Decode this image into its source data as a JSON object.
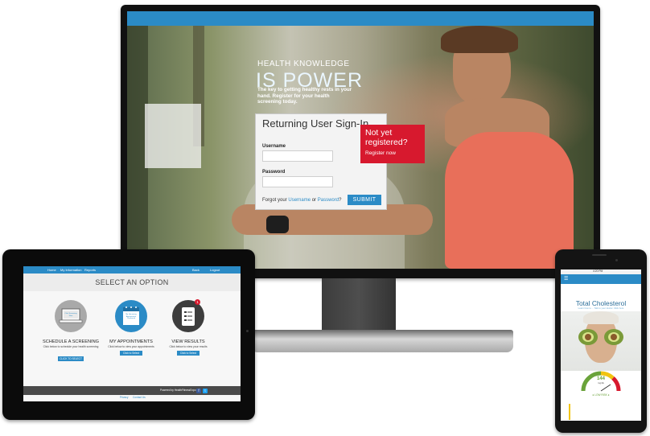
{
  "monitor": {
    "hero": {
      "title_small": "HEALTH KNOWLEDGE",
      "title_big": "IS POWER",
      "subtitle": "The key to getting healthy rests in your hand. Register for your health screening today."
    },
    "signin": {
      "title": "Returning User Sign-In",
      "username_label": "Username",
      "username_value": "",
      "password_label": "Password",
      "password_value": "",
      "forgot_prefix": "Forgot your",
      "forgot_username": "Username",
      "forgot_or": "or",
      "forgot_password": "Password",
      "forgot_suffix": "?",
      "submit_label": "SUBMIT"
    },
    "register": {
      "title": "Not yet registered?",
      "link": "Register now"
    }
  },
  "tablet": {
    "nav_left": [
      "Home",
      "My Information",
      "Reports"
    ],
    "nav_right": [
      "Back",
      "Logout"
    ],
    "heading": "SELECT AN OPTION",
    "options": [
      {
        "title": "SCHEDULE A SCREENING",
        "desc": "Click below to schedule your health screening",
        "button": "CLICK TO SELECT",
        "icon": "laptop-icon",
        "icon_label": "Click Screening Now",
        "circle_color": "#a9a9a9"
      },
      {
        "title": "MY APPOINTMENTS",
        "desc": "Click below to view your appointments",
        "button": "Click to Select",
        "icon": "calendar-icon",
        "icon_label": "My Upcoming Appointment Confirmed",
        "circle_color": "#2b8bc6"
      },
      {
        "title": "VIEW RESULTS",
        "desc": "Click below to view your results",
        "button": "Click to Select",
        "icon": "tablet-results-icon",
        "badge": "1",
        "circle_color": "#3d3d3d"
      }
    ],
    "footer_text": "Powered by HealthFitnessExpo",
    "footer_links": [
      "Privacy",
      "Contact Us"
    ],
    "social": [
      "f",
      "t"
    ]
  },
  "phone": {
    "status_time": "4:20 PM",
    "menu_icon": "hamburger-icon",
    "title": "Total Cholesterol",
    "subtitle": "Learn how to ... Talk to your doctor. Click here",
    "gauge_value": "144",
    "gauge_unit": "mg/dL",
    "gauge_status": "● LOW RISK ●",
    "colors": {
      "accent": "#2b8bc6",
      "gauge_good": "#6aa33a"
    }
  }
}
